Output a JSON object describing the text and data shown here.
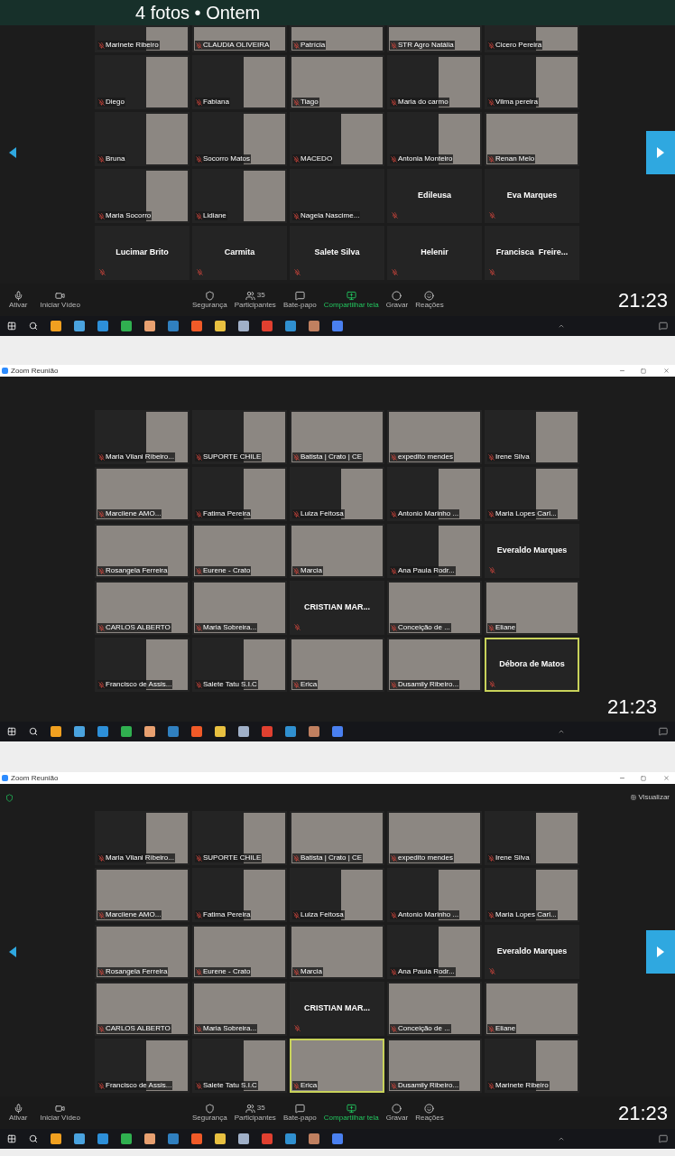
{
  "gallery_header": {
    "title": "4 fotos • Ontem"
  },
  "screens": [
    {
      "nav_arrows": true,
      "first_row_cut": true,
      "tiles": [
        {
          "kind": "video",
          "name": "Marinete Ribeiro",
          "speaking": false
        },
        {
          "kind": "video-wide",
          "name": "CLAUDIA OLIVEIRA",
          "speaking": false
        },
        {
          "kind": "video-wide",
          "name": "Patrícia",
          "speaking": false
        },
        {
          "kind": "video-wide",
          "name": "STR Agro Natália",
          "speaking": false
        },
        {
          "kind": "video",
          "name": "Cicero Pereira",
          "speaking": false
        },
        {
          "kind": "video",
          "name": "Diego",
          "speaking": false
        },
        {
          "kind": "video",
          "name": "Fabiana",
          "speaking": false
        },
        {
          "kind": "video-wide",
          "name": "Tiago",
          "speaking": false
        },
        {
          "kind": "video",
          "name": "Maria do carmo",
          "speaking": false
        },
        {
          "kind": "video",
          "name": "Vilma pereira",
          "speaking": false
        },
        {
          "kind": "video",
          "name": "Bruna",
          "speaking": false
        },
        {
          "kind": "video",
          "name": "Socorro Matos",
          "speaking": false
        },
        {
          "kind": "video",
          "name": "MACEDO",
          "speaking": false
        },
        {
          "kind": "video",
          "name": "Antonia Monteiro",
          "speaking": false
        },
        {
          "kind": "video-wide",
          "name": "Renan Melo",
          "speaking": false
        },
        {
          "kind": "video",
          "name": "Maria Socorro",
          "speaking": false
        },
        {
          "kind": "video",
          "name": "Lidiane",
          "speaking": false
        },
        {
          "kind": "label",
          "name": "Nagela Nascime...",
          "speaking": false
        },
        {
          "kind": "name",
          "name": "Edileusa",
          "speaking": false
        },
        {
          "kind": "name",
          "name": "Eva Marques",
          "speaking": false
        },
        {
          "kind": "name",
          "name": "Lucimar Brito",
          "speaking": false
        },
        {
          "kind": "name",
          "name": "Carmita",
          "speaking": false
        },
        {
          "kind": "name",
          "name": "Salete Silva",
          "speaking": false
        },
        {
          "kind": "name",
          "name": "Helenir",
          "speaking": false
        },
        {
          "kind": "name",
          "name": "Francisca  Freire...",
          "speaking": false
        }
      ],
      "toolbar": [
        {
          "kind": "mic",
          "label": "Ativar"
        },
        {
          "kind": "video",
          "label": "Iniciar Vídeo"
        },
        {
          "kind": "security",
          "label": "Segurança"
        },
        {
          "kind": "participants",
          "label": "Participantes",
          "count": "35"
        },
        {
          "kind": "chat",
          "label": "Bate-papo"
        },
        {
          "kind": "share",
          "label": "Compartilhar tela"
        },
        {
          "kind": "record",
          "label": "Gravar"
        },
        {
          "kind": "reactions",
          "label": "Reações"
        }
      ],
      "timestamp": "21:23"
    },
    {
      "window_title": "Zoom Reunião",
      "nav_arrows": false,
      "first_row_cut": false,
      "tiles": [
        {
          "kind": "video",
          "name": "Maria Vilani Ribeiro...",
          "speaking": false
        },
        {
          "kind": "video",
          "name": "SUPORTE CHILE",
          "speaking": false
        },
        {
          "kind": "video-wide",
          "name": "Batista | Crato | CE",
          "speaking": false
        },
        {
          "kind": "video-wide",
          "name": "expedito mendes",
          "speaking": false
        },
        {
          "kind": "video",
          "name": "Irene Silva",
          "speaking": false
        },
        {
          "kind": "video-wide",
          "name": "Marcilene AMO...",
          "speaking": false
        },
        {
          "kind": "video",
          "name": "Fatima Pereira",
          "speaking": false
        },
        {
          "kind": "video",
          "name": "Luiza Feitosa",
          "speaking": false
        },
        {
          "kind": "video",
          "name": "Antonio Marinho ...",
          "speaking": false
        },
        {
          "kind": "video",
          "name": "Maria Lopes Carl...",
          "speaking": false
        },
        {
          "kind": "video-wide",
          "name": "Rosangela Ferreira",
          "speaking": false
        },
        {
          "kind": "video-wide",
          "name": "Eurene - Crato",
          "speaking": false
        },
        {
          "kind": "video-wide",
          "name": "Marcia",
          "speaking": false
        },
        {
          "kind": "video",
          "name": "Ana Paula Rodr...",
          "speaking": false
        },
        {
          "kind": "name",
          "name": "Everaldo Marques",
          "speaking": false
        },
        {
          "kind": "video-wide",
          "name": "CARLOS ALBERTO",
          "speaking": false
        },
        {
          "kind": "video-wide",
          "name": "Maria Sobreira...",
          "speaking": false
        },
        {
          "kind": "name",
          "name": "CRISTIAN MAR...",
          "speaking": false
        },
        {
          "kind": "video-wide",
          "name": "Conceição de ...",
          "speaking": false
        },
        {
          "kind": "video-wide",
          "name": "Eliane",
          "speaking": false
        },
        {
          "kind": "video",
          "name": "Francisco de Assis...",
          "speaking": false
        },
        {
          "kind": "video",
          "name": "Salete Tatu S.I.C",
          "speaking": false
        },
        {
          "kind": "video-wide",
          "name": "Erica",
          "speaking": false
        },
        {
          "kind": "video-wide",
          "name": "Dusamily Ribeiro...",
          "speaking": false
        },
        {
          "kind": "name",
          "name": "Débora de Matos",
          "speaking": true
        }
      ],
      "timestamp": "21:23"
    },
    {
      "window_title": "Zoom Reunião",
      "view_label": "Visualizar",
      "nav_arrows": true,
      "first_row_cut": false,
      "tiles": [
        {
          "kind": "video",
          "name": "Maria Vilani Ribeiro...",
          "speaking": false
        },
        {
          "kind": "video",
          "name": "SUPORTE CHILE",
          "speaking": false
        },
        {
          "kind": "video-wide",
          "name": "Batista | Crato | CE",
          "speaking": false
        },
        {
          "kind": "video-wide",
          "name": "expedito mendes",
          "speaking": false
        },
        {
          "kind": "video",
          "name": "Irene Silva",
          "speaking": false
        },
        {
          "kind": "video-wide",
          "name": "Marcilene AMO...",
          "speaking": false
        },
        {
          "kind": "video",
          "name": "Fatima Pereira",
          "speaking": false
        },
        {
          "kind": "video",
          "name": "Luiza Feitosa",
          "speaking": false
        },
        {
          "kind": "video",
          "name": "Antonio Marinho ...",
          "speaking": false
        },
        {
          "kind": "video",
          "name": "Maria Lopes Carl...",
          "speaking": false
        },
        {
          "kind": "video-wide",
          "name": "Rosangela Ferreira",
          "speaking": false
        },
        {
          "kind": "video-wide",
          "name": "Eurene - Crato",
          "speaking": false
        },
        {
          "kind": "video-wide",
          "name": "Marcia",
          "speaking": false
        },
        {
          "kind": "video",
          "name": "Ana Paula Rodr...",
          "speaking": false
        },
        {
          "kind": "name",
          "name": "Everaldo Marques",
          "speaking": false
        },
        {
          "kind": "video-wide",
          "name": "CARLOS ALBERTO",
          "speaking": false
        },
        {
          "kind": "video-wide",
          "name": "Maria Sobreira...",
          "speaking": false
        },
        {
          "kind": "name",
          "name": "CRISTIAN MAR...",
          "speaking": false
        },
        {
          "kind": "video-wide",
          "name": "Conceição de ...",
          "speaking": false
        },
        {
          "kind": "video-wide",
          "name": "Eliane",
          "speaking": false
        },
        {
          "kind": "video",
          "name": "Francisco de Assis...",
          "speaking": false
        },
        {
          "kind": "video",
          "name": "Salete Tatu S.I.C",
          "speaking": false
        },
        {
          "kind": "video-wide",
          "name": "Erica",
          "speaking": true
        },
        {
          "kind": "video-wide",
          "name": "Dusamily Ribeiro...",
          "speaking": false
        },
        {
          "kind": "video",
          "name": "Marinete Ribeiro",
          "speaking": false
        }
      ],
      "toolbar": [
        {
          "kind": "mic",
          "label": "Ativar"
        },
        {
          "kind": "video",
          "label": "Iniciar Vídeo"
        },
        {
          "kind": "security",
          "label": "Segurança"
        },
        {
          "kind": "participants",
          "label": "Participantes",
          "count": "35"
        },
        {
          "kind": "chat",
          "label": "Bate-papo"
        },
        {
          "kind": "share",
          "label": "Compartilhar tela"
        },
        {
          "kind": "record",
          "label": "Gravar"
        },
        {
          "kind": "reactions",
          "label": "Reações"
        }
      ],
      "timestamp": "21:23"
    }
  ]
}
